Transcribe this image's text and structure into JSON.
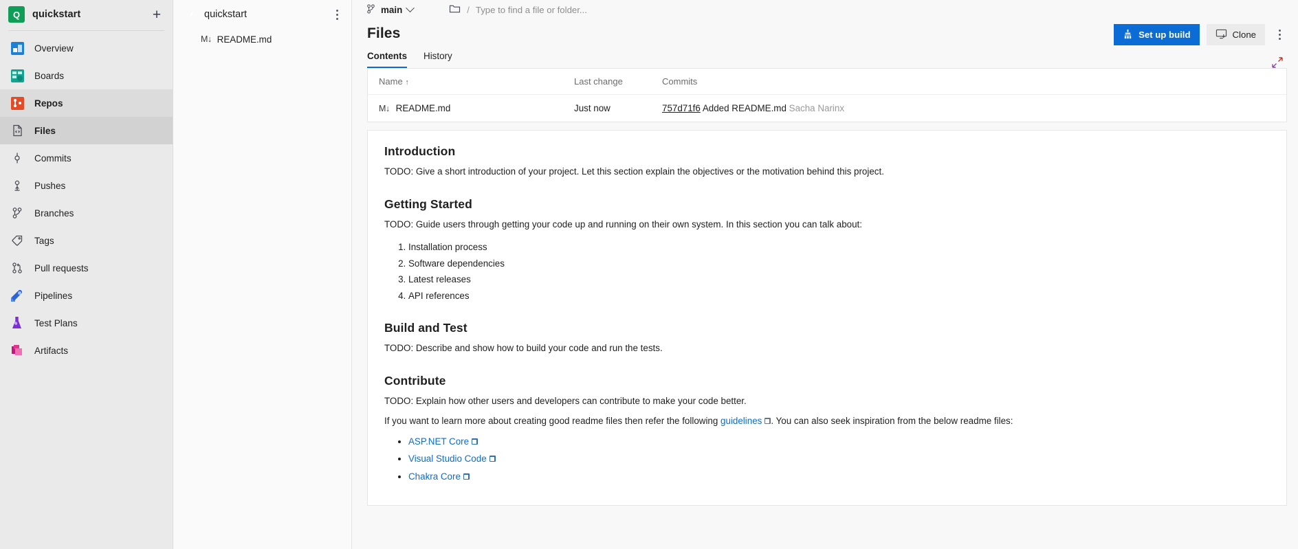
{
  "sidebar": {
    "project": {
      "initial": "Q",
      "name": "quickstart",
      "add_label": "+"
    },
    "items": [
      {
        "label": "Overview",
        "icon": "overview-icon"
      },
      {
        "label": "Boards",
        "icon": "boards-icon"
      },
      {
        "label": "Repos",
        "icon": "repos-icon"
      },
      {
        "label": "Files",
        "icon": "file-code-icon"
      },
      {
        "label": "Commits",
        "icon": "commit-icon"
      },
      {
        "label": "Pushes",
        "icon": "push-icon"
      },
      {
        "label": "Branches",
        "icon": "branch-icon"
      },
      {
        "label": "Tags",
        "icon": "tag-icon"
      },
      {
        "label": "Pull requests",
        "icon": "pull-request-icon"
      },
      {
        "label": "Pipelines",
        "icon": "pipelines-icon"
      },
      {
        "label": "Test Plans",
        "icon": "test-plans-icon"
      },
      {
        "label": "Artifacts",
        "icon": "artifacts-icon"
      }
    ]
  },
  "tree": {
    "repo_name": "quickstart",
    "files": [
      {
        "name": "README.md",
        "type_label": "M↓"
      }
    ]
  },
  "topbar": {
    "branch": "main",
    "path_separator": "/",
    "search_placeholder": "Type to find a file or folder..."
  },
  "header": {
    "title": "Files",
    "tabs": [
      {
        "label": "Contents",
        "active": true
      },
      {
        "label": "History",
        "active": false
      }
    ],
    "setup_build_label": "Set up build",
    "clone_label": "Clone"
  },
  "file_table": {
    "columns": {
      "name": "Name",
      "sort_arrow": "↑",
      "last_change": "Last change",
      "commits": "Commits"
    },
    "rows": [
      {
        "type_label": "M↓",
        "name": "README.md",
        "last_change": "Just now",
        "commit_hash": "757d71f6",
        "commit_message": "Added README.md",
        "author": "Sacha Narinx"
      }
    ]
  },
  "readme": {
    "sections": [
      {
        "heading": "Introduction",
        "paragraph": "TODO: Give a short introduction of your project. Let this section explain the objectives or the motivation behind this project."
      },
      {
        "heading": "Getting Started",
        "paragraph": "TODO: Guide users through getting your code up and running on their own system. In this section you can talk about:",
        "ordered_list": [
          "Installation process",
          "Software dependencies",
          "Latest releases",
          "API references"
        ]
      },
      {
        "heading": "Build and Test",
        "paragraph": "TODO: Describe and show how to build your code and run the tests."
      },
      {
        "heading": "Contribute",
        "paragraph": "TODO: Explain how other users and developers can contribute to make your code better."
      }
    ],
    "closing": {
      "before_link": "If you want to learn more about creating good readme files then refer the following ",
      "link_label": "guidelines",
      "after_link": ". You can also seek inspiration from the below readme files:",
      "links": [
        {
          "label": "ASP.NET Core"
        },
        {
          "label": "Visual Studio Code"
        },
        {
          "label": "Chakra Core"
        }
      ]
    }
  },
  "colors": {
    "accent": "#0a6cd4",
    "sidebar_bg": "#eaeaea",
    "repo_icon": "#e8583a",
    "project_avatar": "#0f9d58"
  }
}
